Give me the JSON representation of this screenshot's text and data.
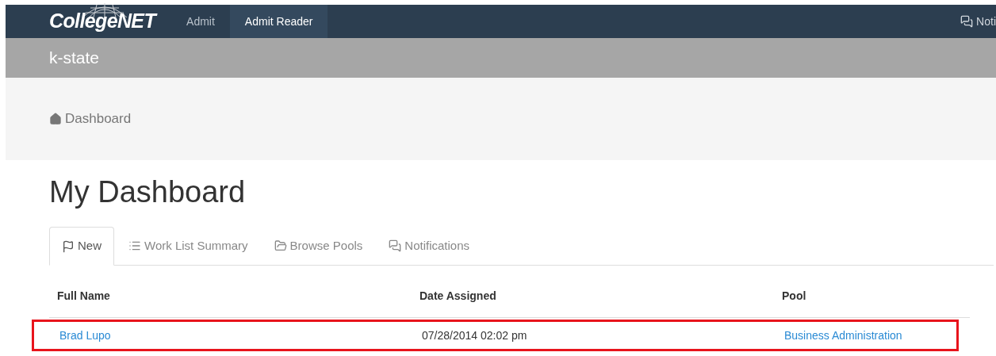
{
  "navbar": {
    "logo": "CollegeNET",
    "items": [
      {
        "label": "Admit",
        "selected": false
      },
      {
        "label": "Admit Reader",
        "selected": true
      }
    ],
    "notifications": "Noti"
  },
  "org_bar": {
    "title": "k-state"
  },
  "breadcrumb": {
    "label": "Dashboard"
  },
  "page_title": "My Dashboard",
  "tabs": [
    {
      "label": "New",
      "selected": true
    },
    {
      "label": "Work List Summary",
      "selected": false
    },
    {
      "label": "Browse Pools",
      "selected": false
    },
    {
      "label": "Notifications",
      "selected": false
    }
  ],
  "table": {
    "columns": [
      "Full Name",
      "Date Assigned",
      "Pool"
    ],
    "rows": [
      {
        "full_name": "Brad Lupo",
        "date_assigned": "07/28/2014 02:02 pm",
        "pool": "Business Administration",
        "highlighted": true
      }
    ]
  }
}
